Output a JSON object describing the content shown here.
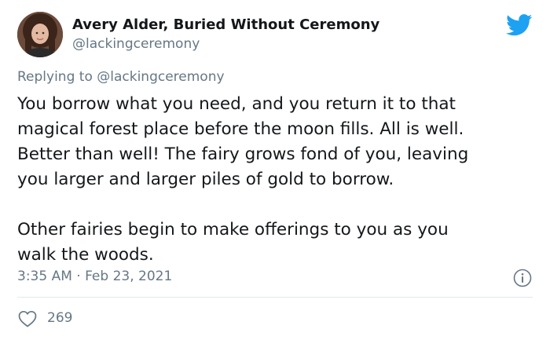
{
  "author": {
    "display_name": "Avery Alder, Buried Without Ceremony",
    "handle": "@lackingceremony"
  },
  "reply": {
    "prefix": "Replying to",
    "mention": "@lackingceremony"
  },
  "tweet": {
    "paragraph1": [
      "You borrow what you need, and you return it to that",
      "magical forest place before the moon fills. All is well.",
      "Better than well! The fairy grows fond of you, leaving",
      "you larger and larger piles of gold to borrow."
    ],
    "paragraph2": [
      "Other fairies begin to make offerings to you as you",
      "walk the woods."
    ]
  },
  "meta": {
    "timestamp": "3:35 AM · Feb 23, 2021"
  },
  "stats": {
    "likes": "269"
  },
  "colors": {
    "twitter_blue": "#1da1f2",
    "secondary_text": "#657786",
    "primary_text": "#14171a",
    "divider": "#e1e8ed"
  },
  "icons": {
    "brand": "twitter-bird-icon",
    "info": "info-icon",
    "like": "heart-outline-icon"
  }
}
